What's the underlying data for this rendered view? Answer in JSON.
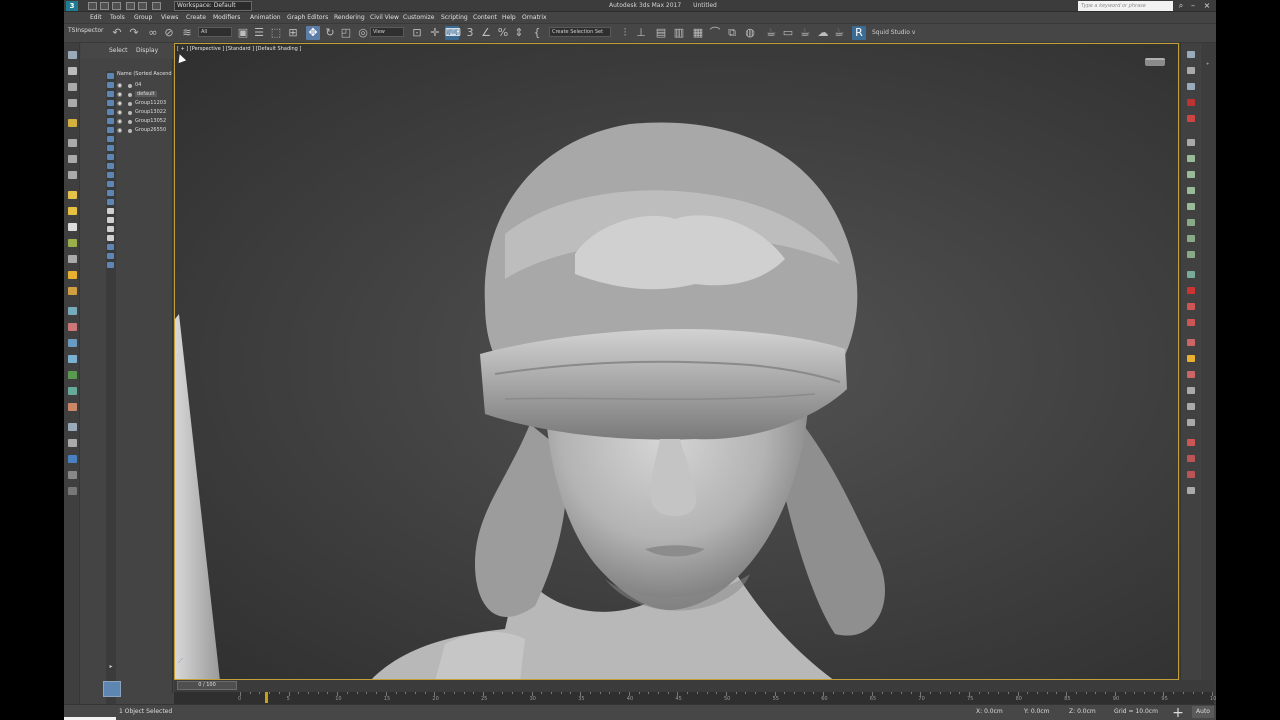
{
  "titlebar": {
    "workspace": "Workspace: Default",
    "app_title": "Autodesk 3ds Max 2017",
    "doc_title": "Untitled",
    "help_search_placeholder": "Type a keyword or phrase"
  },
  "menu": [
    "Edit",
    "Tools",
    "Group",
    "Views",
    "Create",
    "Modifiers",
    "Animation",
    "Graph Editors",
    "Rendering",
    "Civil View",
    "Customize",
    "Scripting",
    "Content",
    "Help",
    "Ornatrix"
  ],
  "toolbar": {
    "ts_inspector": "TSInspector",
    "selection_filter": "All",
    "ref_coord": "View",
    "named_selection_set": "Create Selection Set",
    "squid_studio": "Squid Studio v"
  },
  "scene_explorer": {
    "tab_select": "Select",
    "tab_display": "Display",
    "column_header": "Name (Sorted Ascend",
    "items": [
      {
        "name": "04"
      },
      {
        "name": "default"
      },
      {
        "name": "Group11203"
      },
      {
        "name": "Group13022"
      },
      {
        "name": "Group13052"
      },
      {
        "name": "Group26550"
      }
    ]
  },
  "viewport": {
    "label": "[ + ] [Perspective ] [Standard ] [Default Shading ]"
  },
  "timeline": {
    "slider": "0 / 100",
    "ticks": [
      "0",
      "5",
      "10",
      "15",
      "20",
      "25",
      "30",
      "35",
      "40",
      "45",
      "50",
      "55",
      "60",
      "65",
      "70",
      "75",
      "80",
      "85",
      "90",
      "95",
      "100"
    ]
  },
  "status": {
    "selection": "1 Object Selected",
    "x": "0.0cm",
    "y": "0.0cm",
    "z": "0.0cm",
    "x_label": "X:",
    "y_label": "Y:",
    "z_label": "Z:",
    "grid": "Grid = 10.0cm",
    "auto_key": "Auto"
  },
  "colors": {
    "viewport_border": "#c39f3a",
    "active_tool": "#5b7da8",
    "bust_light": "#c9c9c9",
    "bust_shadow": "#6a6a6a"
  }
}
